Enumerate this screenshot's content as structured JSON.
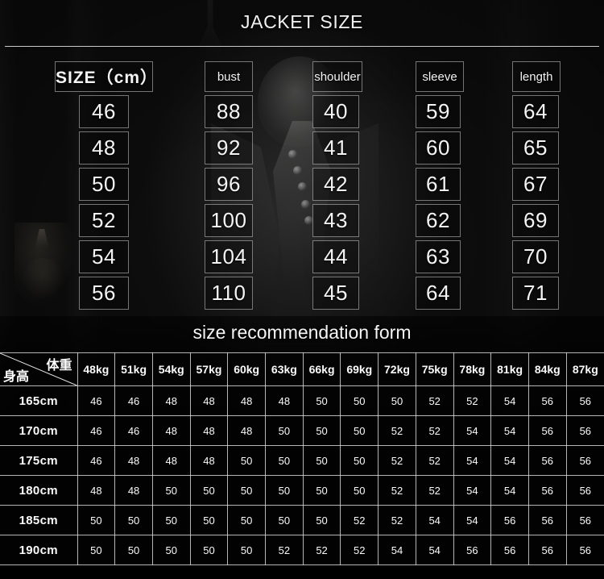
{
  "page": {
    "jacket_title": "JACKET SIZE",
    "recommendation_title": "size recommendation form",
    "accent_line_color": "#ebebeb",
    "text_color": "#f4f4f4",
    "background_color": "#0a0a0a"
  },
  "spec_table": {
    "columns": [
      {
        "key": "size",
        "header": "SIZE（cm）",
        "values": [
          "46",
          "48",
          "50",
          "52",
          "54",
          "56"
        ]
      },
      {
        "key": "bust",
        "header": "bust",
        "values": [
          "88",
          "92",
          "96",
          "100",
          "104",
          "110"
        ]
      },
      {
        "key": "shoulder",
        "header": "shoulder",
        "values": [
          "40",
          "41",
          "42",
          "43",
          "44",
          "45"
        ]
      },
      {
        "key": "sleeve",
        "header": "sleeve",
        "values": [
          "59",
          "60",
          "61",
          "62",
          "63",
          "64"
        ]
      },
      {
        "key": "length",
        "header": "length",
        "values": [
          "64",
          "65",
          "67",
          "69",
          "70",
          "71"
        ]
      }
    ]
  },
  "recommendation_table": {
    "corner": {
      "weight_label": "体重",
      "height_label": "身高"
    },
    "weight_columns": [
      "48kg",
      "51kg",
      "54kg",
      "57kg",
      "60kg",
      "63kg",
      "66kg",
      "69kg",
      "72kg",
      "75kg",
      "78kg",
      "81kg",
      "84kg",
      "87kg"
    ],
    "rows": [
      {
        "height": "165cm",
        "sizes": [
          "46",
          "46",
          "48",
          "48",
          "48",
          "48",
          "50",
          "50",
          "50",
          "52",
          "52",
          "54",
          "56",
          "56"
        ]
      },
      {
        "height": "170cm",
        "sizes": [
          "46",
          "46",
          "48",
          "48",
          "48",
          "50",
          "50",
          "50",
          "52",
          "52",
          "54",
          "54",
          "56",
          "56"
        ]
      },
      {
        "height": "175cm",
        "sizes": [
          "46",
          "48",
          "48",
          "48",
          "50",
          "50",
          "50",
          "50",
          "52",
          "52",
          "54",
          "54",
          "56",
          "56"
        ]
      },
      {
        "height": "180cm",
        "sizes": [
          "48",
          "48",
          "50",
          "50",
          "50",
          "50",
          "50",
          "50",
          "52",
          "52",
          "54",
          "54",
          "56",
          "56"
        ]
      },
      {
        "height": "185cm",
        "sizes": [
          "50",
          "50",
          "50",
          "50",
          "50",
          "50",
          "50",
          "52",
          "52",
          "54",
          "54",
          "56",
          "56",
          "56"
        ]
      },
      {
        "height": "190cm",
        "sizes": [
          "50",
          "50",
          "50",
          "50",
          "50",
          "52",
          "52",
          "52",
          "54",
          "54",
          "56",
          "56",
          "56",
          "56"
        ]
      }
    ]
  }
}
